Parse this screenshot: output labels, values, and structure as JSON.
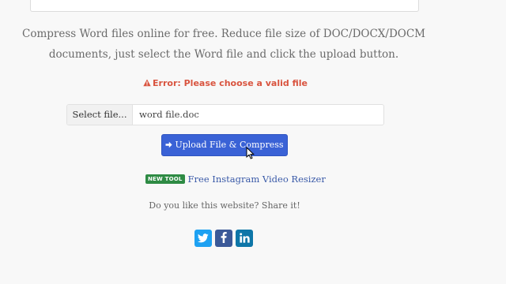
{
  "description": {
    "line1": "Compress Word files online for free. Reduce file size of DOC/DOCX/DOCM",
    "line2": "documents, just select the Word file and click the upload button."
  },
  "error": {
    "message": "Error: Please choose a valid file",
    "icon": "warning-icon",
    "color": "#d9543f"
  },
  "file_input": {
    "button_label": "Select file...",
    "value": "word file.doc"
  },
  "upload": {
    "label": "Upload File & Compress",
    "icon": "arrow-right-icon",
    "color": "#3a62d6"
  },
  "new_tool": {
    "badge": "NEW TOOL",
    "link_text": "Free Instagram Video Resizer",
    "badge_color": "#2e8b44"
  },
  "share": {
    "prompt": "Do you like this website? Share it!",
    "networks": [
      {
        "name": "twitter",
        "icon": "twitter-icon",
        "color": "#1da1f2"
      },
      {
        "name": "facebook",
        "icon": "facebook-icon",
        "color": "#3b5998"
      },
      {
        "name": "linkedin",
        "icon": "linkedin-icon",
        "color": "#0e76a8"
      }
    ]
  }
}
